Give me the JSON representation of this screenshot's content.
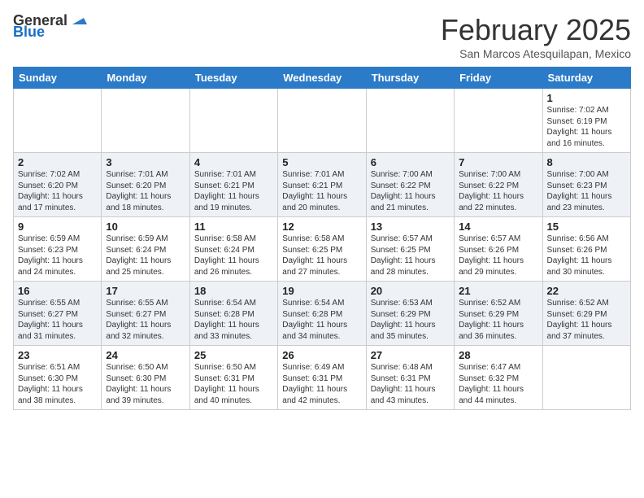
{
  "logo": {
    "general": "General",
    "blue": "Blue"
  },
  "header": {
    "month": "February 2025",
    "location": "San Marcos Atesquilapan, Mexico"
  },
  "weekdays": [
    "Sunday",
    "Monday",
    "Tuesday",
    "Wednesday",
    "Thursday",
    "Friday",
    "Saturday"
  ],
  "weeks": [
    [
      {
        "day": "",
        "info": ""
      },
      {
        "day": "",
        "info": ""
      },
      {
        "day": "",
        "info": ""
      },
      {
        "day": "",
        "info": ""
      },
      {
        "day": "",
        "info": ""
      },
      {
        "day": "",
        "info": ""
      },
      {
        "day": "1",
        "info": "Sunrise: 7:02 AM\nSunset: 6:19 PM\nDaylight: 11 hours and 16 minutes."
      }
    ],
    [
      {
        "day": "2",
        "info": "Sunrise: 7:02 AM\nSunset: 6:20 PM\nDaylight: 11 hours and 17 minutes."
      },
      {
        "day": "3",
        "info": "Sunrise: 7:01 AM\nSunset: 6:20 PM\nDaylight: 11 hours and 18 minutes."
      },
      {
        "day": "4",
        "info": "Sunrise: 7:01 AM\nSunset: 6:21 PM\nDaylight: 11 hours and 19 minutes."
      },
      {
        "day": "5",
        "info": "Sunrise: 7:01 AM\nSunset: 6:21 PM\nDaylight: 11 hours and 20 minutes."
      },
      {
        "day": "6",
        "info": "Sunrise: 7:00 AM\nSunset: 6:22 PM\nDaylight: 11 hours and 21 minutes."
      },
      {
        "day": "7",
        "info": "Sunrise: 7:00 AM\nSunset: 6:22 PM\nDaylight: 11 hours and 22 minutes."
      },
      {
        "day": "8",
        "info": "Sunrise: 7:00 AM\nSunset: 6:23 PM\nDaylight: 11 hours and 23 minutes."
      }
    ],
    [
      {
        "day": "9",
        "info": "Sunrise: 6:59 AM\nSunset: 6:23 PM\nDaylight: 11 hours and 24 minutes."
      },
      {
        "day": "10",
        "info": "Sunrise: 6:59 AM\nSunset: 6:24 PM\nDaylight: 11 hours and 25 minutes."
      },
      {
        "day": "11",
        "info": "Sunrise: 6:58 AM\nSunset: 6:24 PM\nDaylight: 11 hours and 26 minutes."
      },
      {
        "day": "12",
        "info": "Sunrise: 6:58 AM\nSunset: 6:25 PM\nDaylight: 11 hours and 27 minutes."
      },
      {
        "day": "13",
        "info": "Sunrise: 6:57 AM\nSunset: 6:25 PM\nDaylight: 11 hours and 28 minutes."
      },
      {
        "day": "14",
        "info": "Sunrise: 6:57 AM\nSunset: 6:26 PM\nDaylight: 11 hours and 29 minutes."
      },
      {
        "day": "15",
        "info": "Sunrise: 6:56 AM\nSunset: 6:26 PM\nDaylight: 11 hours and 30 minutes."
      }
    ],
    [
      {
        "day": "16",
        "info": "Sunrise: 6:55 AM\nSunset: 6:27 PM\nDaylight: 11 hours and 31 minutes."
      },
      {
        "day": "17",
        "info": "Sunrise: 6:55 AM\nSunset: 6:27 PM\nDaylight: 11 hours and 32 minutes."
      },
      {
        "day": "18",
        "info": "Sunrise: 6:54 AM\nSunset: 6:28 PM\nDaylight: 11 hours and 33 minutes."
      },
      {
        "day": "19",
        "info": "Sunrise: 6:54 AM\nSunset: 6:28 PM\nDaylight: 11 hours and 34 minutes."
      },
      {
        "day": "20",
        "info": "Sunrise: 6:53 AM\nSunset: 6:29 PM\nDaylight: 11 hours and 35 minutes."
      },
      {
        "day": "21",
        "info": "Sunrise: 6:52 AM\nSunset: 6:29 PM\nDaylight: 11 hours and 36 minutes."
      },
      {
        "day": "22",
        "info": "Sunrise: 6:52 AM\nSunset: 6:29 PM\nDaylight: 11 hours and 37 minutes."
      }
    ],
    [
      {
        "day": "23",
        "info": "Sunrise: 6:51 AM\nSunset: 6:30 PM\nDaylight: 11 hours and 38 minutes."
      },
      {
        "day": "24",
        "info": "Sunrise: 6:50 AM\nSunset: 6:30 PM\nDaylight: 11 hours and 39 minutes."
      },
      {
        "day": "25",
        "info": "Sunrise: 6:50 AM\nSunset: 6:31 PM\nDaylight: 11 hours and 40 minutes."
      },
      {
        "day": "26",
        "info": "Sunrise: 6:49 AM\nSunset: 6:31 PM\nDaylight: 11 hours and 42 minutes."
      },
      {
        "day": "27",
        "info": "Sunrise: 6:48 AM\nSunset: 6:31 PM\nDaylight: 11 hours and 43 minutes."
      },
      {
        "day": "28",
        "info": "Sunrise: 6:47 AM\nSunset: 6:32 PM\nDaylight: 11 hours and 44 minutes."
      },
      {
        "day": "",
        "info": ""
      }
    ]
  ]
}
